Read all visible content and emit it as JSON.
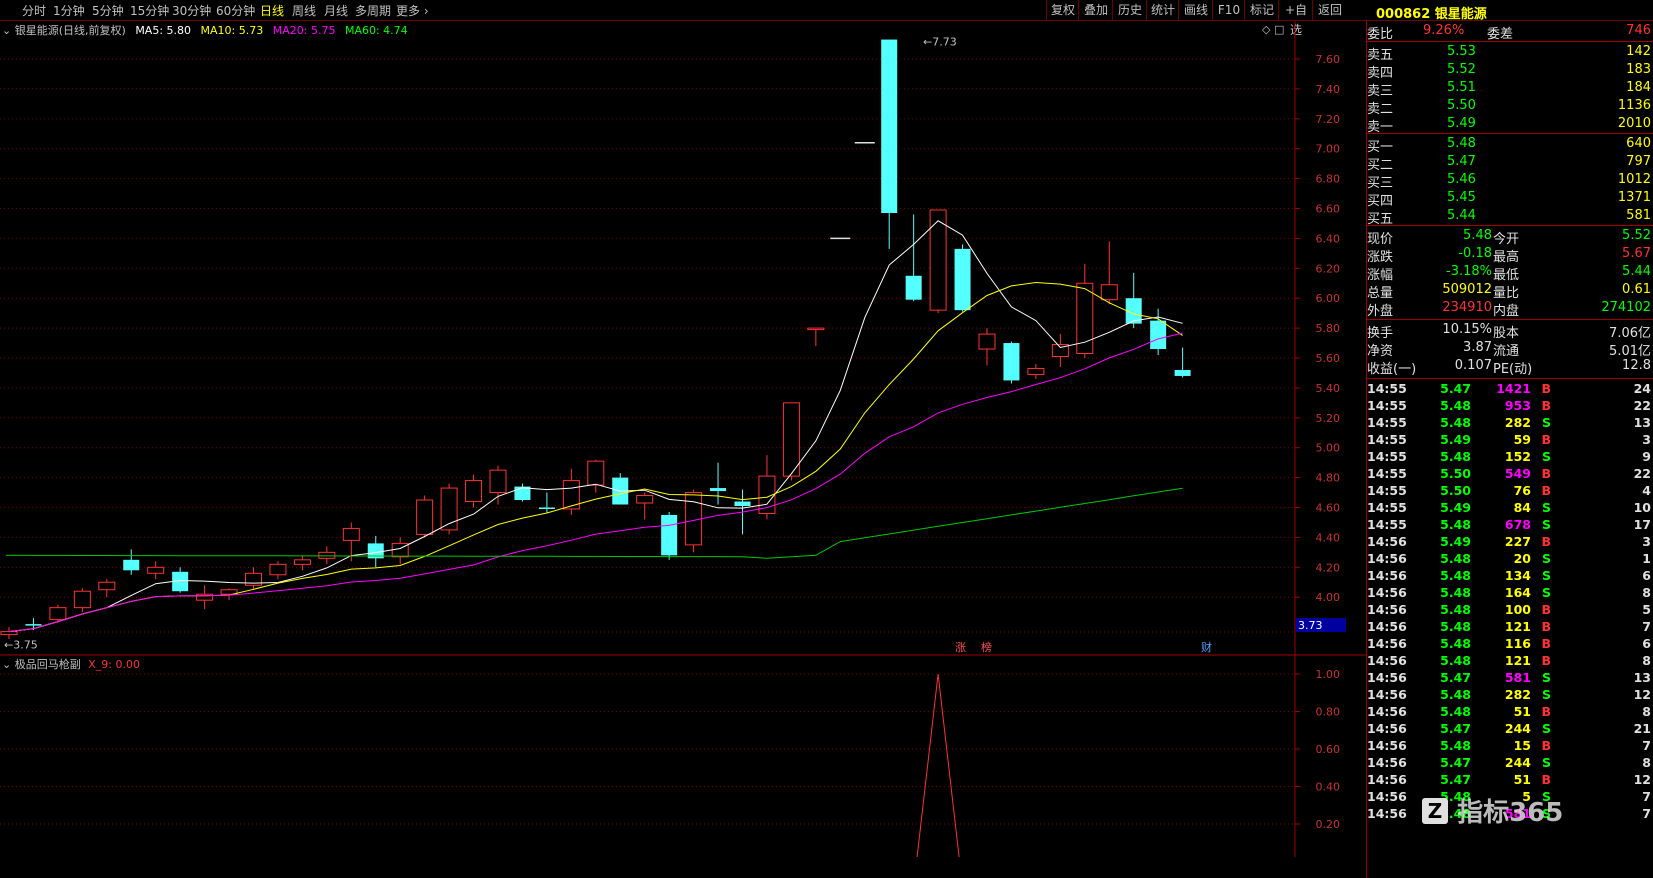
{
  "toolbar": {
    "periods": [
      "分时",
      "1分钟",
      "5分钟",
      "15分钟",
      "30分钟",
      "60分钟",
      "日线",
      "周线",
      "月线",
      "多周期",
      "更多"
    ],
    "active_period": "日线",
    "right_buttons": [
      "复权",
      "叠加",
      "历史",
      "统计",
      "画线",
      "F10",
      "标记",
      "+自选",
      "返回"
    ]
  },
  "stock": {
    "code": "000862",
    "name": "银星能源"
  },
  "main_legend": {
    "title": "银星能源(日线,前复权)",
    "ma5": "MA5: 5.80",
    "ma10": "MA10: 5.73",
    "ma20": "MA20: 5.75",
    "ma60": "MA60: 4.74",
    "colors": {
      "ma5": "#ffffff",
      "ma10": "#ffff00",
      "ma20": "#ff00ff",
      "ma60": "#00ff00"
    }
  },
  "main_axis": {
    "ticks": [
      "7.60",
      "7.40",
      "7.20",
      "7.00",
      "6.80",
      "6.60",
      "6.40",
      "6.20",
      "6.00",
      "5.80",
      "5.60",
      "5.40",
      "5.20",
      "5.00",
      "4.80",
      "4.60",
      "4.40",
      "4.20",
      "4.00"
    ],
    "current_marker": "3.73",
    "high_label": "7.73",
    "low_label": "3.75"
  },
  "markers": {
    "zhang": "涨",
    "bang": "榜",
    "cai": "财"
  },
  "sub_legend": {
    "title": "极品回马枪副",
    "value": "X_9: 0.00"
  },
  "sub_axis": {
    "ticks": [
      "1.00",
      "0.80",
      "0.60",
      "0.40",
      "0.20"
    ]
  },
  "chart_data": {
    "type": "candlestick",
    "candles_ohlc": [
      [
        3.75,
        3.8,
        3.72,
        3.77
      ],
      [
        3.82,
        3.86,
        3.78,
        3.81
      ],
      [
        3.85,
        3.95,
        3.83,
        3.93
      ],
      [
        3.93,
        4.06,
        3.9,
        4.04
      ],
      [
        4.05,
        4.12,
        4.0,
        4.1
      ],
      [
        4.25,
        4.32,
        4.15,
        4.18
      ],
      [
        4.16,
        4.24,
        4.12,
        4.2
      ],
      [
        4.17,
        4.2,
        4.03,
        4.04
      ],
      [
        3.98,
        4.08,
        3.92,
        4.02
      ],
      [
        4.02,
        4.06,
        3.98,
        4.05
      ],
      [
        4.08,
        4.2,
        4.05,
        4.16
      ],
      [
        4.15,
        4.24,
        4.12,
        4.22
      ],
      [
        4.22,
        4.28,
        4.18,
        4.25
      ],
      [
        4.26,
        4.34,
        4.22,
        4.3
      ],
      [
        4.38,
        4.5,
        4.24,
        4.46
      ],
      [
        4.36,
        4.41,
        4.2,
        4.26
      ],
      [
        4.27,
        4.4,
        4.22,
        4.36
      ],
      [
        4.42,
        4.68,
        4.4,
        4.65
      ],
      [
        4.45,
        4.76,
        4.42,
        4.73
      ],
      [
        4.64,
        4.82,
        4.6,
        4.78
      ],
      [
        4.7,
        4.88,
        4.62,
        4.85
      ],
      [
        4.74,
        4.76,
        4.64,
        4.65
      ],
      [
        4.6,
        4.7,
        4.56,
        4.59
      ],
      [
        4.59,
        4.86,
        4.55,
        4.78
      ],
      [
        4.75,
        4.92,
        4.7,
        4.91
      ],
      [
        4.8,
        4.83,
        4.62,
        4.62
      ],
      [
        4.63,
        4.7,
        4.52,
        4.68
      ],
      [
        4.55,
        4.57,
        4.25,
        4.28
      ],
      [
        4.35,
        4.72,
        4.3,
        4.7
      ],
      [
        4.73,
        4.9,
        4.62,
        4.71
      ],
      [
        4.64,
        4.72,
        4.42,
        4.61
      ],
      [
        4.56,
        4.95,
        4.52,
        4.81
      ],
      [
        4.81,
        5.3,
        4.78,
        5.3
      ],
      [
        5.8,
        5.8,
        5.68,
        5.8
      ],
      [
        6.4,
        6.4,
        6.4,
        6.4
      ],
      [
        7.04,
        7.04,
        7.04,
        7.04
      ],
      [
        7.73,
        7.73,
        6.33,
        6.57
      ],
      [
        6.15,
        6.56,
        5.98,
        5.99
      ],
      [
        5.92,
        6.59,
        5.9,
        6.59
      ],
      [
        6.33,
        6.36,
        5.91,
        5.92
      ],
      [
        5.66,
        5.8,
        5.55,
        5.76
      ],
      [
        5.7,
        5.71,
        5.43,
        5.45
      ],
      [
        5.49,
        5.56,
        5.46,
        5.53
      ],
      [
        5.61,
        5.76,
        5.54,
        5.69
      ],
      [
        5.63,
        6.23,
        5.6,
        6.1
      ],
      [
        5.99,
        6.38,
        5.96,
        6.09
      ],
      [
        6.0,
        6.17,
        5.8,
        5.83
      ],
      [
        5.85,
        5.93,
        5.62,
        5.66
      ],
      [
        5.52,
        5.67,
        5.47,
        5.48
      ]
    ],
    "ma_last": {
      "MA5": 5.8,
      "MA10": 5.73,
      "MA20": 5.75,
      "MA60": 4.74
    },
    "indicator": {
      "name": "X_9",
      "values_nonzero": [
        {
          "candle_index": 38,
          "value": 1.0
        }
      ]
    }
  },
  "panel": {
    "weibi": {
      "label": "委比",
      "value": "9.26%",
      "label2": "委差",
      "value2": "746"
    },
    "sell": [
      {
        "label": "卖五",
        "price": "5.53",
        "vol": "142"
      },
      {
        "label": "卖四",
        "price": "5.52",
        "vol": "183"
      },
      {
        "label": "卖三",
        "price": "5.51",
        "vol": "184"
      },
      {
        "label": "卖二",
        "price": "5.50",
        "vol": "1136"
      },
      {
        "label": "卖一",
        "price": "5.49",
        "vol": "2010"
      }
    ],
    "buy": [
      {
        "label": "买一",
        "price": "5.48",
        "vol": "640"
      },
      {
        "label": "买二",
        "price": "5.47",
        "vol": "797"
      },
      {
        "label": "买三",
        "price": "5.46",
        "vol": "1012"
      },
      {
        "label": "买四",
        "price": "5.45",
        "vol": "1371"
      },
      {
        "label": "买五",
        "price": "5.44",
        "vol": "581"
      }
    ],
    "quote": [
      {
        "l1": "现价",
        "v1": "5.48",
        "l2": "今开",
        "v2": "5.52",
        "c1": "g",
        "c2": "g"
      },
      {
        "l1": "涨跌",
        "v1": "-0.18",
        "l2": "最高",
        "v2": "5.67",
        "c1": "g",
        "c2": "r"
      },
      {
        "l1": "涨幅",
        "v1": "-3.18%",
        "l2": "最低",
        "v2": "5.44",
        "c1": "g",
        "c2": "g"
      },
      {
        "l1": "总量",
        "v1": "509012",
        "l2": "量比",
        "v2": "0.61",
        "c1": "y",
        "c2": "y"
      },
      {
        "l1": "外盘",
        "v1": "234910",
        "l2": "内盘",
        "v2": "274102",
        "c1": "r",
        "c2": "g"
      }
    ],
    "finance": [
      {
        "l1": "换手",
        "v1": "10.15%",
        "l2": "股本",
        "v2": "7.06亿"
      },
      {
        "l1": "净资",
        "v1": "3.87",
        "l2": "流通",
        "v2": "5.01亿"
      },
      {
        "l1": "收益(一)",
        "v1": "0.107",
        "l2": "PE(动)",
        "v2": "12.8"
      }
    ],
    "ticks": [
      {
        "t": "14:55",
        "p": "5.47",
        "v": "1421",
        "bs": "B",
        "n": "24"
      },
      {
        "t": "14:55",
        "p": "5.48",
        "v": "953",
        "bs": "B",
        "n": "22"
      },
      {
        "t": "14:55",
        "p": "5.48",
        "v": "282",
        "bs": "S",
        "n": "13"
      },
      {
        "t": "14:55",
        "p": "5.49",
        "v": "59",
        "bs": "B",
        "n": "3"
      },
      {
        "t": "14:55",
        "p": "5.48",
        "v": "152",
        "bs": "S",
        "n": "9"
      },
      {
        "t": "14:55",
        "p": "5.50",
        "v": "549",
        "bs": "B",
        "n": "22"
      },
      {
        "t": "14:55",
        "p": "5.50",
        "v": "76",
        "bs": "B",
        "n": "4"
      },
      {
        "t": "14:55",
        "p": "5.49",
        "v": "84",
        "bs": "S",
        "n": "10"
      },
      {
        "t": "14:55",
        "p": "5.48",
        "v": "678",
        "bs": "S",
        "n": "17"
      },
      {
        "t": "14:56",
        "p": "5.49",
        "v": "227",
        "bs": "B",
        "n": "3"
      },
      {
        "t": "14:56",
        "p": "5.48",
        "v": "20",
        "bs": "S",
        "n": "1"
      },
      {
        "t": "14:56",
        "p": "5.48",
        "v": "134",
        "bs": "S",
        "n": "6"
      },
      {
        "t": "14:56",
        "p": "5.48",
        "v": "164",
        "bs": "S",
        "n": "8"
      },
      {
        "t": "14:56",
        "p": "5.48",
        "v": "100",
        "bs": "B",
        "n": "5"
      },
      {
        "t": "14:56",
        "p": "5.48",
        "v": "121",
        "bs": "B",
        "n": "7"
      },
      {
        "t": "14:56",
        "p": "5.48",
        "v": "116",
        "bs": "B",
        "n": "6"
      },
      {
        "t": "14:56",
        "p": "5.48",
        "v": "121",
        "bs": "B",
        "n": "8"
      },
      {
        "t": "14:56",
        "p": "5.47",
        "v": "581",
        "bs": "S",
        "n": "13"
      },
      {
        "t": "14:56",
        "p": "5.48",
        "v": "282",
        "bs": "S",
        "n": "12"
      },
      {
        "t": "14:56",
        "p": "5.48",
        "v": "51",
        "bs": "B",
        "n": "8"
      },
      {
        "t": "14:56",
        "p": "5.47",
        "v": "244",
        "bs": "S",
        "n": "21"
      },
      {
        "t": "14:56",
        "p": "5.48",
        "v": "15",
        "bs": "B",
        "n": "7"
      },
      {
        "t": "14:56",
        "p": "5.47",
        "v": "244",
        "bs": "S",
        "n": "8"
      },
      {
        "t": "14:56",
        "p": "5.47",
        "v": "51",
        "bs": "B",
        "n": "12"
      },
      {
        "t": "14:56",
        "p": "5.48",
        "v": "5",
        "bs": "S",
        "n": "7"
      },
      {
        "t": "14:56",
        "p": "5.48",
        "v": "581",
        "bs": "S",
        "n": "7"
      }
    ]
  },
  "watermark": "指标365"
}
